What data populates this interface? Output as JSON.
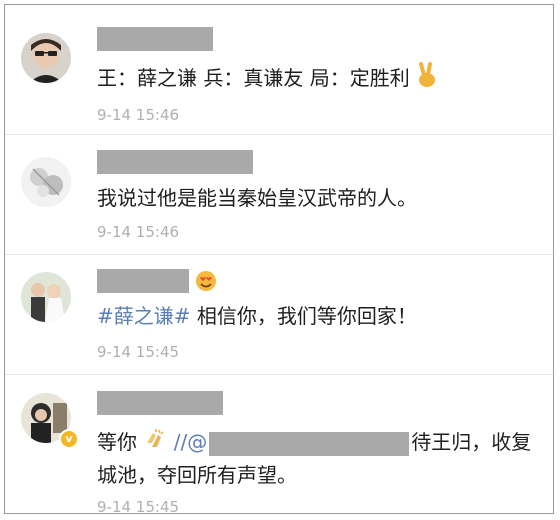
{
  "comments": [
    {
      "text": "王：薛之谦 兵：真谦友 局：定胜利",
      "emoji": "victory-hand",
      "time": "9-14 15:46"
    },
    {
      "text": "我说过他是能当秦始皇汉武帝的人。",
      "time": "9-14 15:46"
    },
    {
      "hashtag": "#薛之谦#",
      "text": " 相信你，我们等你回家！",
      "name_emoji": "heart-eyes-face",
      "time": "9-14 15:45"
    },
    {
      "text_before": "等你",
      "emoji": "clapping-hands",
      "mention_prefix": " //@",
      "text_after": "待王归，收复",
      "text_line2": "城池，夺回所有声望。",
      "verified": "v",
      "time": "9-14 15:45"
    }
  ],
  "colors": {
    "redaction": "#a9a9a9",
    "hashtag": "#5a7fb5",
    "timestamp": "#b0b0b0",
    "verified_badge": "#f5b623"
  }
}
